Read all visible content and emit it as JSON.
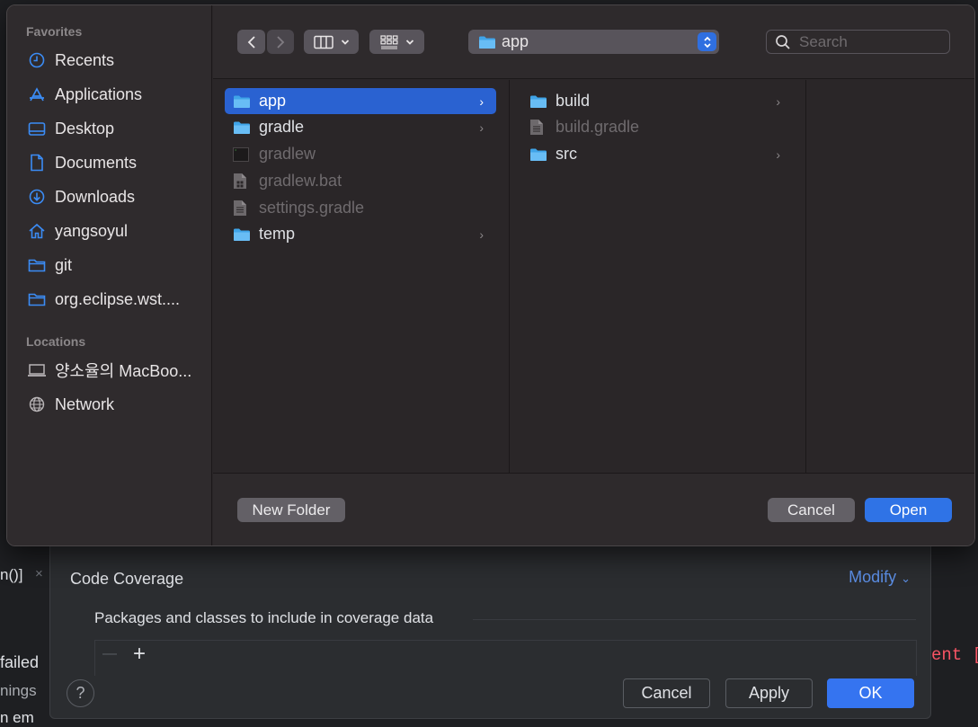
{
  "background": {
    "left_fragments": [
      "n()]",
      "×",
      "failed",
      "nings",
      "n em"
    ],
    "right_fragment": "ent ["
  },
  "run_config": {
    "section_title": "Code Coverage",
    "modify_label": "Modify",
    "subsection": "Packages and classes to include in coverage data",
    "remove_icon": "—",
    "add_icon": "+",
    "help_label": "?",
    "cancel_label": "Cancel",
    "apply_label": "Apply",
    "ok_label": "OK"
  },
  "finder": {
    "sidebar": {
      "favorites_heading": "Favorites",
      "favorites": [
        {
          "label": "Recents",
          "icon": "clock-icon"
        },
        {
          "label": "Applications",
          "icon": "applications-icon"
        },
        {
          "label": "Desktop",
          "icon": "desktop-icon"
        },
        {
          "label": "Documents",
          "icon": "document-icon"
        },
        {
          "label": "Downloads",
          "icon": "download-icon"
        },
        {
          "label": "yangsoyul",
          "icon": "home-icon"
        },
        {
          "label": "git",
          "icon": "folder-icon"
        },
        {
          "label": "org.eclipse.wst....",
          "icon": "folder-icon"
        }
      ],
      "locations_heading": "Locations",
      "locations": [
        {
          "label": "양소율의 MacBoo...",
          "icon": "laptop-icon"
        },
        {
          "label": "Network",
          "icon": "network-icon"
        }
      ]
    },
    "toolbar": {
      "path_label": "app",
      "search_placeholder": "Search"
    },
    "column1": [
      {
        "label": "app",
        "type": "folder",
        "selected": true,
        "enabled": true,
        "has_children": true
      },
      {
        "label": "gradle",
        "type": "folder",
        "selected": false,
        "enabled": true,
        "has_children": true
      },
      {
        "label": "gradlew",
        "type": "exec",
        "selected": false,
        "enabled": false,
        "has_children": false
      },
      {
        "label": "gradlew.bat",
        "type": "file",
        "selected": false,
        "enabled": false,
        "has_children": false
      },
      {
        "label": "settings.gradle",
        "type": "file",
        "selected": false,
        "enabled": false,
        "has_children": false
      },
      {
        "label": "temp",
        "type": "folder",
        "selected": false,
        "enabled": true,
        "has_children": true
      }
    ],
    "column2": [
      {
        "label": "build",
        "type": "folder",
        "enabled": true,
        "has_children": true
      },
      {
        "label": "build.gradle",
        "type": "file",
        "enabled": false,
        "has_children": false
      },
      {
        "label": "src",
        "type": "folder",
        "enabled": true,
        "has_children": true
      }
    ],
    "buttons": {
      "new_folder": "New Folder",
      "cancel": "Cancel",
      "open": "Open"
    }
  }
}
